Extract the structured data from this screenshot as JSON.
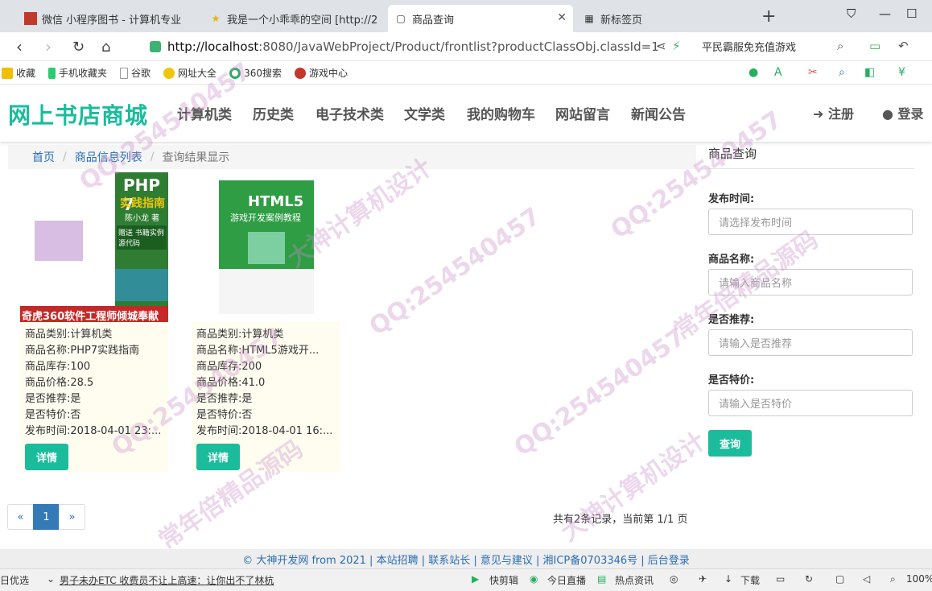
{
  "browser": {
    "tabs": [
      {
        "title": "微信 小程序图书 - 计算机专业",
        "icon_color": "#c0392b"
      },
      {
        "title": "我是一个小乖乖的空间 [http://2",
        "icon_color": "#e6b400"
      },
      {
        "title": "商品查询",
        "icon_color": "#888888"
      },
      {
        "title": "新标签页",
        "icon_color": "#888888"
      }
    ],
    "url_host": "http://localhost",
    "url_rest": ":8080/JavaWebProject/Product/frontlist?productClassObj.classId=1",
    "search_hint": "平民霸服免充值游戏",
    "bookmarks": [
      "收藏",
      "手机收藏夹",
      "谷歌",
      "网址大全",
      "360搜索",
      "游戏中心"
    ]
  },
  "site": {
    "brand": "网上书店商城",
    "nav": [
      "计算机类",
      "历史类",
      "电子技术类",
      "文学类",
      "我的购物车",
      "网站留言",
      "新闻公告"
    ],
    "register": "注册",
    "login": "登录"
  },
  "breadcrumb": [
    "首页",
    "商品信息列表",
    "查询结果显示"
  ],
  "products": [
    {
      "category": "商品类别:计算机类",
      "name": "商品名称:PHP7实践指南",
      "stock": "商品库存:100",
      "price": "商品价格:28.5",
      "recommend": "是否推荐:是",
      "special": "是否特价:否",
      "publish": "发布时间:2018-04-01 23:...",
      "cover_title": "PHP 7",
      "cover_subtitle": "实践指南",
      "cover_author": "陈小龙 著",
      "cover_banner": "奇虎360软件工程师倾城奉献",
      "cover_gift": "赠送 书籍实例源代码",
      "detail_label": "详情"
    },
    {
      "category": "商品类别:计算机类",
      "name": "商品名称:HTML5游戏开...",
      "stock": "商品库存:200",
      "price": "商品价格:41.0",
      "recommend": "是否推荐:是",
      "special": "是否特价:否",
      "publish": "发布时间:2018-04-01 16:...",
      "cover_title": "HTML5",
      "cover_subtitle": "游戏开发案例教程",
      "detail_label": "详情"
    }
  ],
  "search_panel": {
    "title": "商品查询",
    "fields": [
      {
        "label": "发布时间:",
        "placeholder": "请选择发布时间"
      },
      {
        "label": "商品名称:",
        "placeholder": "请输入商品名称"
      },
      {
        "label": "是否推荐:",
        "placeholder": "请输入是否推荐"
      },
      {
        "label": "是否特价:",
        "placeholder": "请输入是否特价"
      }
    ],
    "submit": "查询"
  },
  "pagination": {
    "prev": "«",
    "current": "1",
    "next": "»",
    "info": "共有2条记录，当前第 1/1 页"
  },
  "footer": "© 大神开发网 from 2021 | 本站招聘 | 联系站长 | 意见与建议 | 湘ICP备0703346号 | 后台登录",
  "statusbar": {
    "left": "日优选",
    "news": "男子未办ETC 收费员不让上高速：让你出不了林杭",
    "items": [
      "快剪辑",
      "今日直播",
      "热点资讯",
      "下载"
    ],
    "zoom": "100%"
  },
  "watermarks": [
    "QQ:254540457",
    "大神计算机设计",
    "常年倍精品源码"
  ],
  "colors": {
    "accent": "#1abc9c",
    "link": "#2a6eb5",
    "page_active": "#337ab7"
  }
}
